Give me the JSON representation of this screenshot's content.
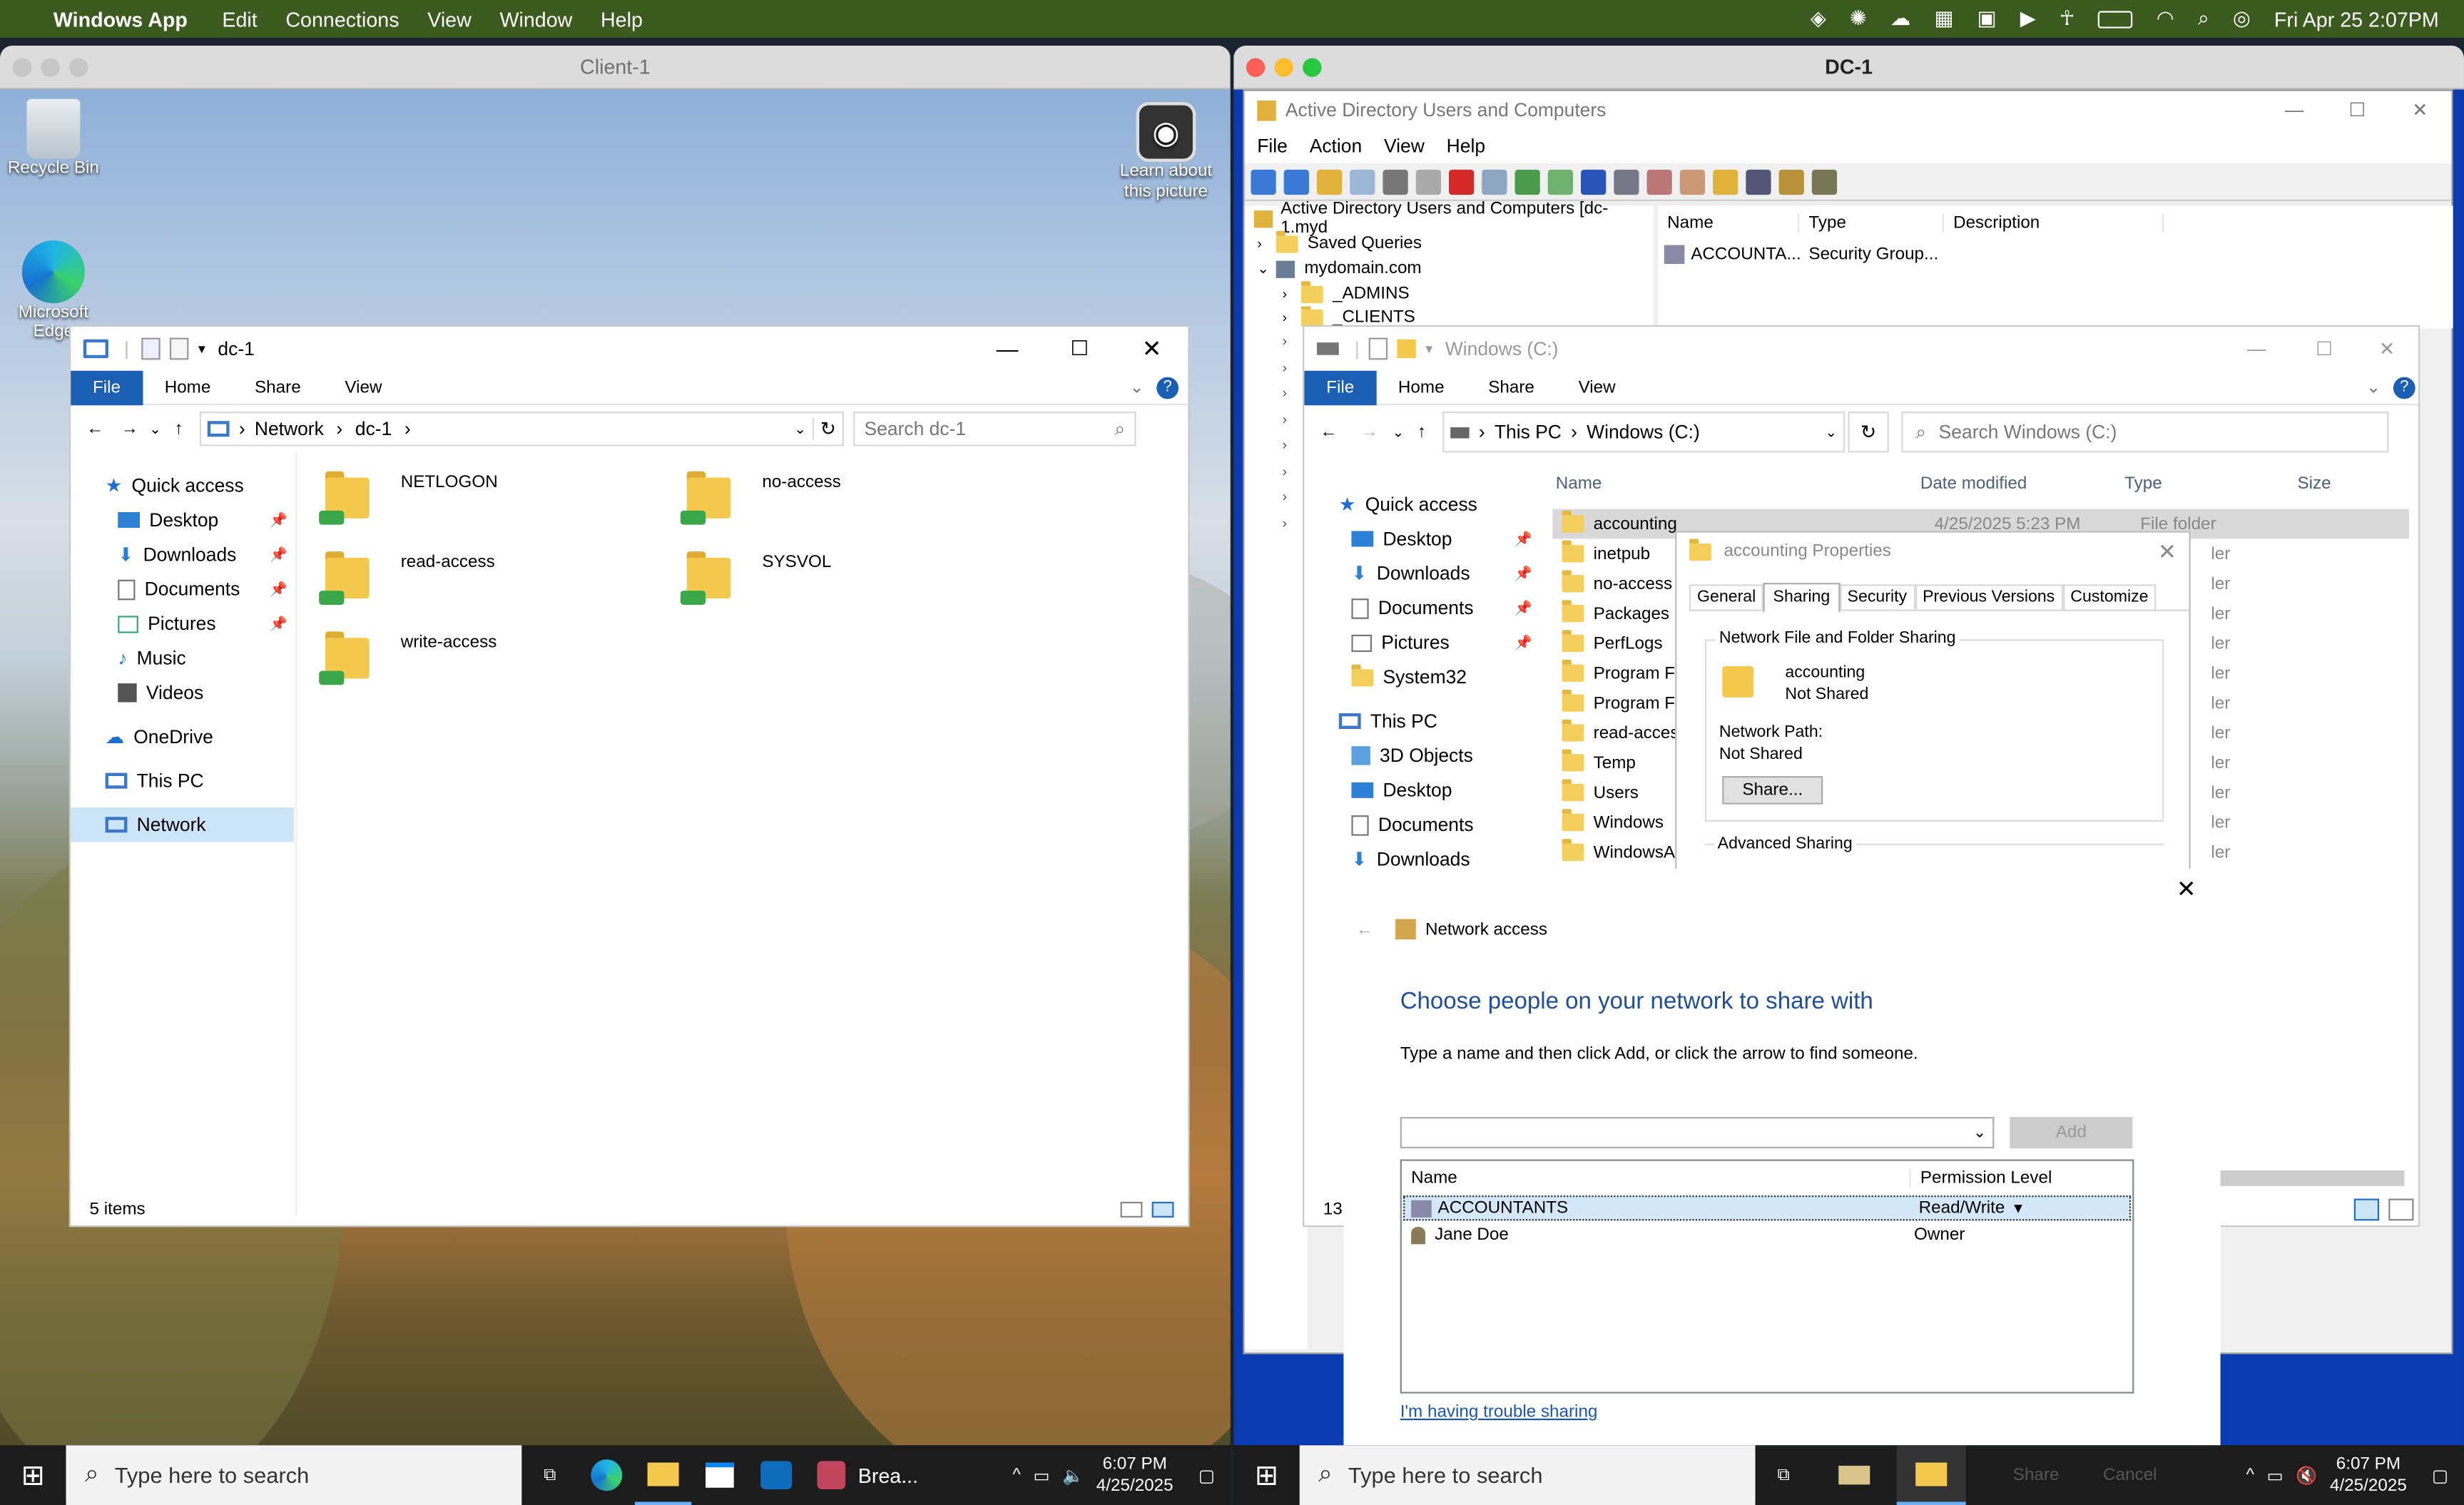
{
  "menubar": {
    "app": "Windows App",
    "items": [
      "Edit",
      "Connections",
      "View",
      "Window",
      "Help"
    ],
    "datetime": "Fri Apr 25  2:07PM"
  },
  "win1": {
    "title": "Client-1"
  },
  "win2": {
    "title": "DC-1"
  },
  "desktop1": {
    "recycle": "Recycle Bin",
    "edge": "Microsoft Edge",
    "learn": "Learn about this picture"
  },
  "explorer1": {
    "title": "dc-1",
    "tabs": [
      "File",
      "Home",
      "Share",
      "View"
    ],
    "path": [
      "Network",
      "dc-1"
    ],
    "search_placeholder": "Search dc-1",
    "nav": {
      "quick": "Quick access",
      "items": [
        "Desktop",
        "Downloads",
        "Documents",
        "Pictures",
        "Music",
        "Videos"
      ],
      "onedrive": "OneDrive",
      "thispc": "This PC",
      "network": "Network"
    },
    "folders": [
      "NETLOGON",
      "no-access",
      "read-access",
      "SYSVOL",
      "write-access"
    ],
    "status": "5 items"
  },
  "aduc": {
    "title": "Active Directory Users and Computers",
    "menu": [
      "File",
      "Action",
      "View",
      "Help"
    ],
    "tree": {
      "root": "Active Directory Users and Computers [dc-1.myd",
      "saved": "Saved Queries",
      "domain": "mydomain.com",
      "admins": "_ADMINS",
      "clients": "_CLIENTS"
    },
    "cols": [
      "Name",
      "Type",
      "Description"
    ],
    "row": {
      "name": "ACCOUNTA...",
      "type": "Security Group..."
    }
  },
  "explorer2": {
    "title": "Windows (C:)",
    "tabs": [
      "File",
      "Home",
      "Share",
      "View"
    ],
    "path": [
      "This PC",
      "Windows (C:)"
    ],
    "search_placeholder": "Search Windows (C:)",
    "nav": {
      "quick": "Quick access",
      "items": [
        "Desktop",
        "Downloads",
        "Documents",
        "Pictures",
        "System32"
      ],
      "thispc": "This PC",
      "pcitems": [
        "3D Objects",
        "Desktop",
        "Documents",
        "Downloads"
      ]
    },
    "cols": [
      "Name",
      "Date modified",
      "Type",
      "Size"
    ],
    "files": [
      "accounting",
      "inetpub",
      "no-access",
      "Packages",
      "PerfLogs",
      "Program Fil",
      "Program Fil",
      "read-access",
      "Temp",
      "Users",
      "Windows",
      "WindowsAz"
    ],
    "first_date": "4/25/2025 5:23 PM",
    "first_type": "File folder",
    "type_short": "ler",
    "status_num": "13"
  },
  "props": {
    "title": "accounting Properties",
    "tabs": [
      "General",
      "Sharing",
      "Security",
      "Previous Versions",
      "Customize"
    ],
    "group": "Network File and Folder Sharing",
    "name": "accounting",
    "state": "Not Shared",
    "path_label": "Network Path:",
    "path_value": "Not Shared",
    "share_btn": "Share...",
    "advanced": "Advanced Sharing"
  },
  "netaccess": {
    "header": "Network access",
    "heading": "Choose people on your network to share with",
    "instr": "Type a name and then click Add, or click the arrow to find someone.",
    "add": "Add",
    "col_name": "Name",
    "col_perm": "Permission Level",
    "rows": [
      {
        "name": "ACCOUNTANTS",
        "perm": "Read/Write"
      },
      {
        "name": "Jane Doe",
        "perm": "Owner"
      }
    ],
    "trouble": "I'm having trouble sharing",
    "share": "Share",
    "cancel": "Cancel"
  },
  "taskbar1": {
    "search": "Type here to search",
    "bre": "Brea...",
    "time": "6:07 PM",
    "date": "4/25/2025"
  },
  "taskbar2": {
    "search": "Type here to search",
    "time": "6:07 PM",
    "date": "4/25/2025"
  }
}
